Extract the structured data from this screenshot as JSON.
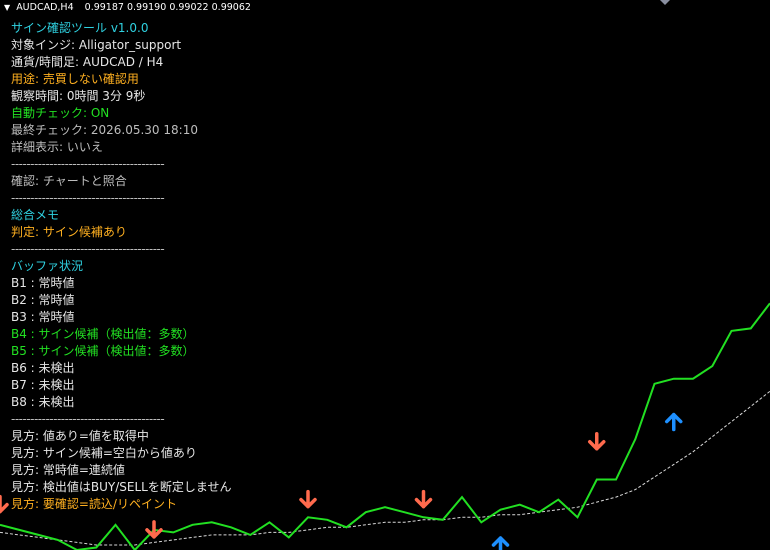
{
  "window": {
    "symbol": "AUDCAD,H4",
    "quotes": [
      "0.99187",
      "0.99190",
      "0.99022",
      "0.99062"
    ]
  },
  "panel": {
    "title": "サイン確認ツール v1.0.0",
    "indicator": "対象インジ: Alligator_support",
    "pair_tf": "通貨/時間足: AUDCAD / H4",
    "purpose": "用途: 売買しない確認用",
    "observe": "観察時間: 0時間 3分 9秒",
    "auto": "自動チェック: ON",
    "last": "最終チェック: 2026.05.30 18:10",
    "detail": "詳細表示: いいえ",
    "sep1": "----------------------------------------",
    "confirm": "確認: チャートと照合",
    "sep2": "----------------------------------------",
    "memo_title": "総合メモ",
    "judge": "判定: サイン候補あり",
    "sep3": "----------------------------------------",
    "buffer_title": "バッファ状況",
    "buffers": [
      "B1 : 常時値",
      "B2 : 常時値",
      "B3 : 常時値",
      "B4 : サイン候補（検出値：多数）",
      "B5 : サイン候補（検出値：多数）",
      "B6 : 未検出",
      "B7 : 未検出",
      "B8 : 未検出"
    ],
    "sep4": "----------------------------------------",
    "notes": [
      "見方: 値あり=値を取得中",
      "見方: サイン候補=空白から値あり",
      "見方: 常時値=連続値",
      "見方: 検出値はBUY/SELLを断定しません",
      "見方: 要確認=読込/リペイント"
    ]
  },
  "colors": {
    "background": "#000000",
    "price_line": "#22e022",
    "ma_line": "#d8d8d8",
    "buy_arrow": "#1e90ff",
    "sell_arrow": "#ff6a4d",
    "cyan_text": "#2fd1e0",
    "orange_text": "#ffb020",
    "green_text": "#22e022"
  },
  "chart_data": {
    "type": "line",
    "series": [
      {
        "values": [
          0.987,
          0.9868,
          0.9866,
          0.9864,
          0.986,
          0.9861,
          0.987,
          0.986,
          0.9868,
          0.9867,
          0.987,
          0.9871,
          0.9869,
          0.9866,
          0.9871,
          0.9865,
          0.9873,
          0.9872,
          0.9869,
          0.9875,
          0.9877,
          0.9875,
          0.9873,
          0.9872,
          0.9881,
          0.9871,
          0.9876,
          0.9878,
          0.9875,
          0.988,
          0.9873,
          0.9888,
          0.9888,
          0.9904,
          0.9926,
          0.9928,
          0.9928,
          0.9933,
          0.9947,
          0.9948,
          0.9958
        ]
      },
      {
        "values": [
          0.9867,
          0.9866,
          0.9865,
          0.9864,
          0.9863,
          0.9862,
          0.9862,
          0.9862,
          0.9863,
          0.9864,
          0.9865,
          0.9866,
          0.9866,
          0.9866,
          0.9867,
          0.9867,
          0.9868,
          0.9869,
          0.9869,
          0.987,
          0.9871,
          0.9871,
          0.9872,
          0.9872,
          0.9873,
          0.9873,
          0.9874,
          0.9874,
          0.9875,
          0.9876,
          0.9877,
          0.9879,
          0.9881,
          0.9884,
          0.9889,
          0.9894,
          0.9899,
          0.9905,
          0.9911,
          0.9917,
          0.9923
        ]
      }
    ],
    "signals": [
      {
        "kind": "sell",
        "index": 0,
        "price": 0.9878
      },
      {
        "kind": "sell",
        "index": 8,
        "price": 0.9868
      },
      {
        "kind": "sell",
        "index": 16,
        "price": 0.988
      },
      {
        "kind": "sell",
        "index": 22,
        "price": 0.988
      },
      {
        "kind": "sell",
        "index": 31,
        "price": 0.9903
      },
      {
        "kind": "buy",
        "index": 26,
        "price": 0.9862
      },
      {
        "kind": "buy",
        "index": 35,
        "price": 0.9911
      }
    ],
    "ylim": [
      0.986,
      0.9968
    ]
  }
}
